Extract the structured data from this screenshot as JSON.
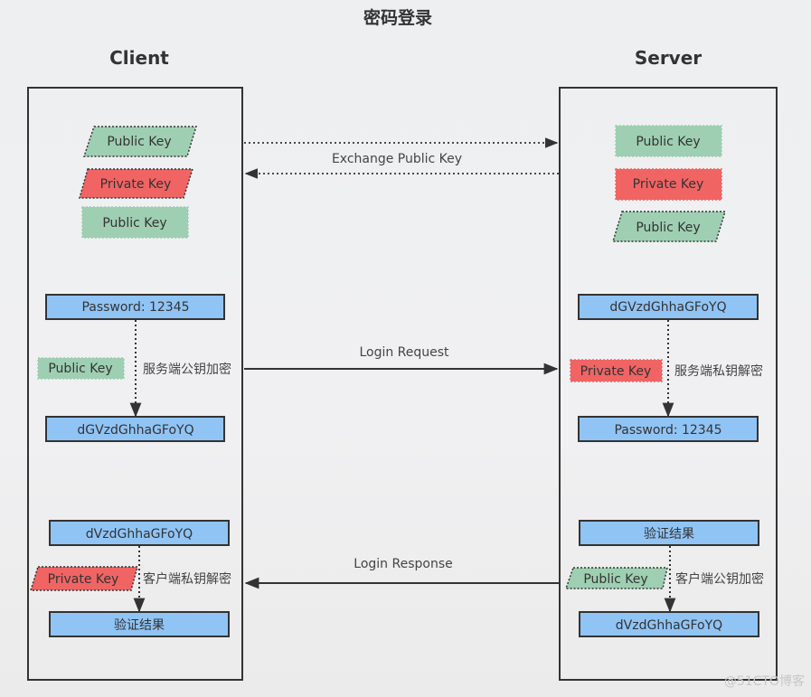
{
  "title": "密码登录",
  "colors": {
    "green": "#9ecfb2",
    "red": "#f06464",
    "blue": "#90c4f5",
    "stroke": "#333333"
  },
  "lanes": {
    "client": "Client",
    "server": "Server"
  },
  "client": {
    "keys": [
      "Public Key",
      "Private Key",
      "Public Key"
    ],
    "encrypt": {
      "input": "Password: 12345",
      "key": "Public Key",
      "note": "服务端公钥加密",
      "output": "dGVzdGhhaGFoYQ"
    },
    "decrypt": {
      "input": "dVzdGhhaGFoYQ",
      "key": "Private Key",
      "note": "客户端私钥解密",
      "output": "验证结果"
    }
  },
  "server": {
    "keys": [
      "Public Key",
      "Private Key",
      "Public Key"
    ],
    "decrypt": {
      "input": "dGVzdGhhaGFoYQ",
      "key": "Private Key",
      "note": "服务端私钥解密",
      "output": "Password: 12345"
    },
    "encrypt": {
      "input": "验证结果",
      "key": "Public Key",
      "note": "客户端公钥加密",
      "output": "dVzdGhhaGFoYQ"
    }
  },
  "edges": {
    "exchange": "Exchange Public Key",
    "request": "Login Request",
    "response": "Login Response"
  },
  "watermark": "@51CTO博客"
}
